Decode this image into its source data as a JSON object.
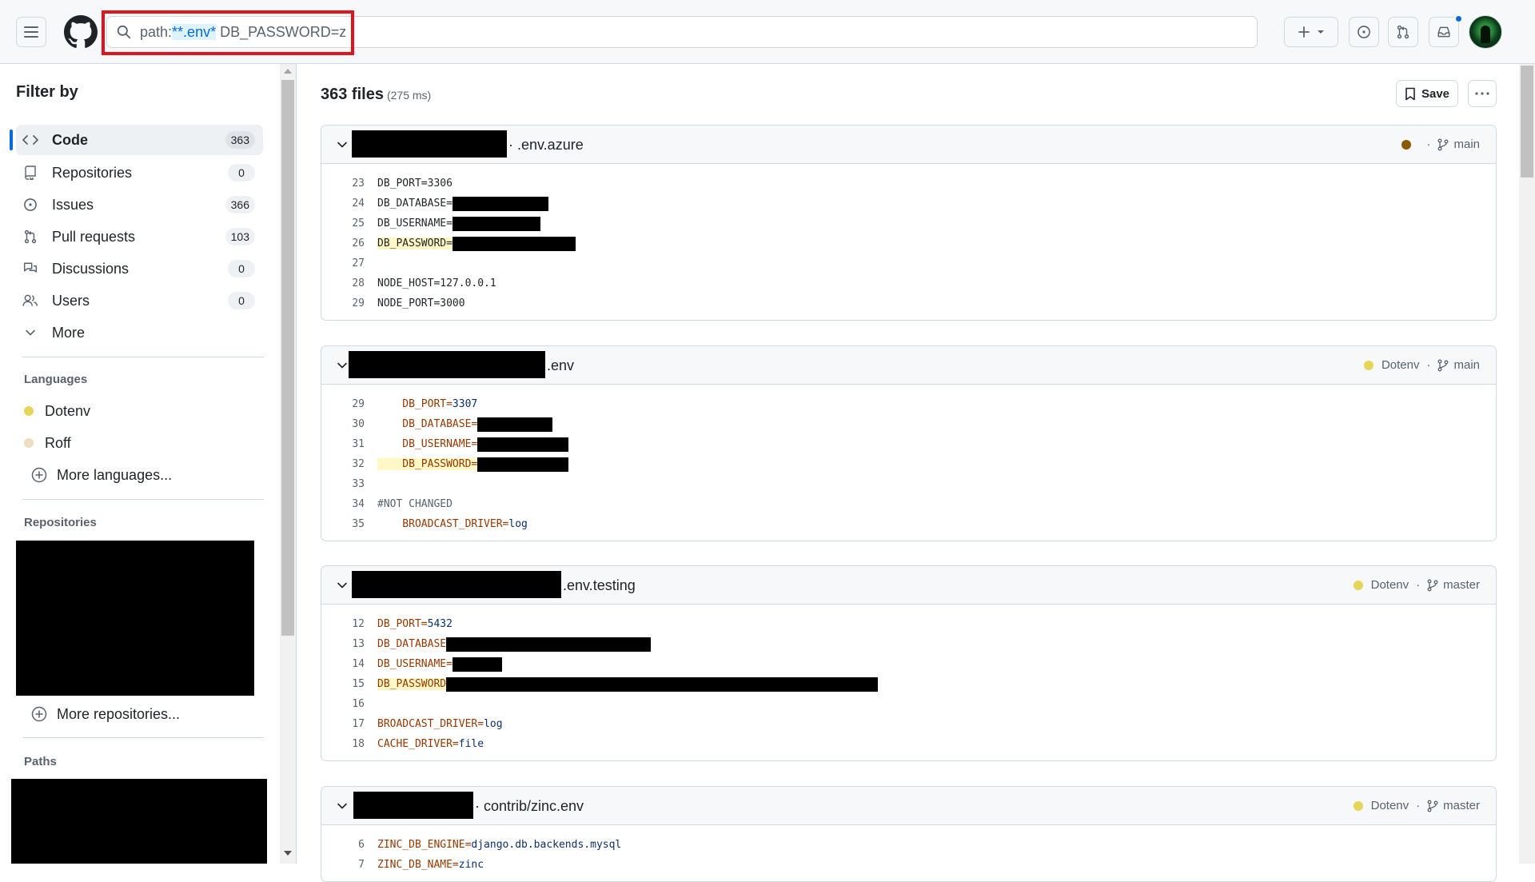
{
  "header": {
    "search": {
      "prefix": "path:",
      "highlighted": "**.env*",
      "rest": " DB_PASSWORD=z"
    }
  },
  "sidebar": {
    "title": "Filter by",
    "items": [
      {
        "label": "Code",
        "count": "363",
        "icon": "code-icon"
      },
      {
        "label": "Repositories",
        "count": "0",
        "icon": "repo-icon"
      },
      {
        "label": "Issues",
        "count": "366",
        "icon": "issue-opened-icon"
      },
      {
        "label": "Pull requests",
        "count": "103",
        "icon": "git-pull-request-icon"
      },
      {
        "label": "Discussions",
        "count": "0",
        "icon": "comment-discussion-icon"
      },
      {
        "label": "Users",
        "count": "0",
        "icon": "people-icon"
      },
      {
        "label": "More",
        "icon": "chevron-down-icon"
      }
    ],
    "languages_title": "Languages",
    "languages": [
      {
        "name": "Dotenv",
        "color": "#e5d559"
      },
      {
        "name": "Roff",
        "color": "#ecdebe"
      }
    ],
    "more_languages": "More languages...",
    "repositories_title": "Repositories",
    "more_repositories": "More repositories...",
    "paths_title": "Paths"
  },
  "results": {
    "count": "363 files",
    "time": "(275 ms)",
    "save_label": "Save"
  },
  "cards": [
    {
      "path": "· .env.azure",
      "language": "",
      "language_color": "#8a5a00",
      "branch": "main",
      "lines": [
        {
          "n": "23",
          "text": "DB_PORT=3306"
        },
        {
          "n": "24",
          "text": "DB_DATABASE="
        },
        {
          "n": "25",
          "text": "DB_USERNAME="
        },
        {
          "n": "26",
          "text": "DB_PASSWORD="
        },
        {
          "n": "27",
          "text": ""
        },
        {
          "n": "28",
          "text": "NODE_HOST=127.0.0.1"
        },
        {
          "n": "29",
          "text": "NODE_PORT=3000"
        }
      ]
    },
    {
      "path": " .env",
      "language": "Dotenv",
      "language_color": "#e5d559",
      "branch": "main",
      "lines": [
        {
          "n": "29",
          "key": "    DB_PORT=",
          "val": "3307"
        },
        {
          "n": "30",
          "key": "    DB_DATABASE="
        },
        {
          "n": "31",
          "key": "    DB_USERNAME="
        },
        {
          "n": "32",
          "key": "    DB_PASSWORD="
        },
        {
          "n": "33",
          "text": ""
        },
        {
          "n": "34",
          "text": "#NOT CHANGED"
        },
        {
          "n": "35",
          "key": "    BROADCAST_DRIVER=",
          "val": "log"
        }
      ]
    },
    {
      "path": " .env.testing",
      "language": "Dotenv",
      "language_color": "#e5d559",
      "branch": "master",
      "lines": [
        {
          "n": "12",
          "key": "DB_PORT=",
          "val": "5432"
        },
        {
          "n": "13",
          "key": "DB_DATABASE"
        },
        {
          "n": "14",
          "key": "DB_USERNAME="
        },
        {
          "n": "15",
          "key": "DB_PASSWORD"
        },
        {
          "n": "16",
          "text": ""
        },
        {
          "n": "17",
          "key": "BROADCAST_DRIVER=",
          "val": "log"
        },
        {
          "n": "18",
          "key": "CACHE_DRIVER=",
          "val": "file"
        }
      ]
    },
    {
      "path": "· contrib/zinc.env",
      "language": "Dotenv",
      "language_color": "#e5d559",
      "branch": "master",
      "lines": [
        {
          "n": "6",
          "key": "ZINC_DB_ENGINE=",
          "val": "django.db.backends.mysql"
        },
        {
          "n": "7",
          "key": "ZINC_DB_NAME=",
          "val": "zinc"
        }
      ]
    }
  ]
}
